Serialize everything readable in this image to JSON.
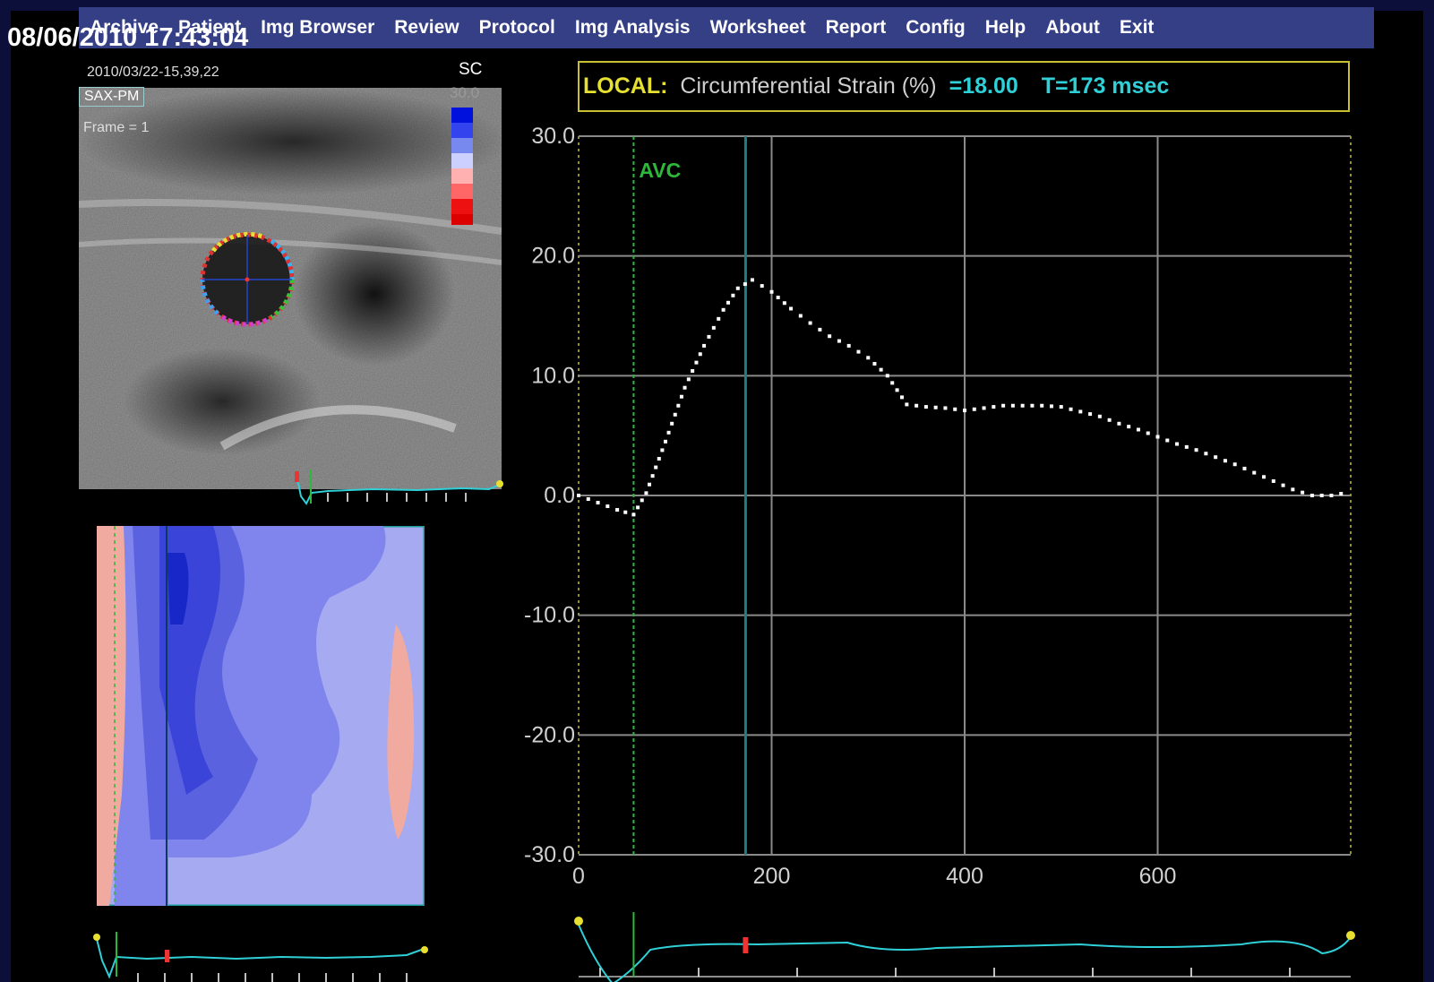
{
  "menu": {
    "items": [
      "Archive",
      "Patient",
      "Img Browser",
      "Review",
      "Protocol",
      "Img Analysis",
      "Worksheet",
      "Report",
      "Config",
      "Help",
      "About",
      "Exit"
    ]
  },
  "datetime": "08/06/2010 17:43:04",
  "ultrasound": {
    "timestamp": "2010/03/22-15,39,22",
    "view": "SAX-PM",
    "frame": "Frame = 1",
    "scale_label": "SC",
    "scale_max": "30.0"
  },
  "header": {
    "local": "LOCAL:",
    "measure": "Circumferential Strain (%)",
    "value": "=18.00",
    "time": "T=173 msec"
  },
  "colors": {
    "curve": "#ffffff",
    "grid": "#8a8a8a",
    "avc": "#2db83a",
    "cursor": "#1d7f86",
    "ecg": "#2fd0d8",
    "header_border": "#c8c030"
  },
  "chart_data": {
    "type": "line",
    "xlim": [
      0,
      800
    ],
    "ylim": [
      -30,
      30
    ],
    "yticks": [
      30,
      20,
      10,
      0,
      -10,
      -20,
      -30
    ],
    "ytick_labels": [
      "30.0",
      "20.0",
      "10.0",
      "0.0",
      "-10.0",
      "-20.0",
      "-30.0"
    ],
    "xticks": [
      0,
      200,
      400,
      600
    ],
    "xtick_labels": [
      "0",
      "200",
      "400",
      "600"
    ],
    "annotation": {
      "label": "AVC",
      "x": 57
    },
    "cursor_x": 173,
    "series": [
      {
        "x": [
          0,
          20,
          40,
          57,
          70,
          90,
          110,
          130,
          150,
          165,
          180,
          200,
          220,
          240,
          260,
          280,
          300,
          320,
          340,
          360,
          380,
          400,
          420,
          440,
          460,
          480,
          500,
          520,
          540,
          560,
          580,
          600,
          620,
          640,
          660,
          680,
          700,
          720,
          740,
          760,
          780,
          800
        ],
        "y": [
          0,
          -0.6,
          -1.2,
          -1.6,
          0.2,
          4.5,
          9.0,
          12.5,
          15.5,
          17.3,
          18.0,
          17.0,
          15.6,
          14.4,
          13.3,
          12.5,
          11.5,
          10.0,
          7.6,
          7.4,
          7.3,
          7.1,
          7.3,
          7.5,
          7.5,
          7.5,
          7.4,
          7.0,
          6.6,
          6.0,
          5.5,
          4.9,
          4.3,
          3.8,
          3.2,
          2.6,
          1.9,
          1.2,
          0.5,
          0.0,
          0.0,
          0.3
        ]
      }
    ]
  }
}
